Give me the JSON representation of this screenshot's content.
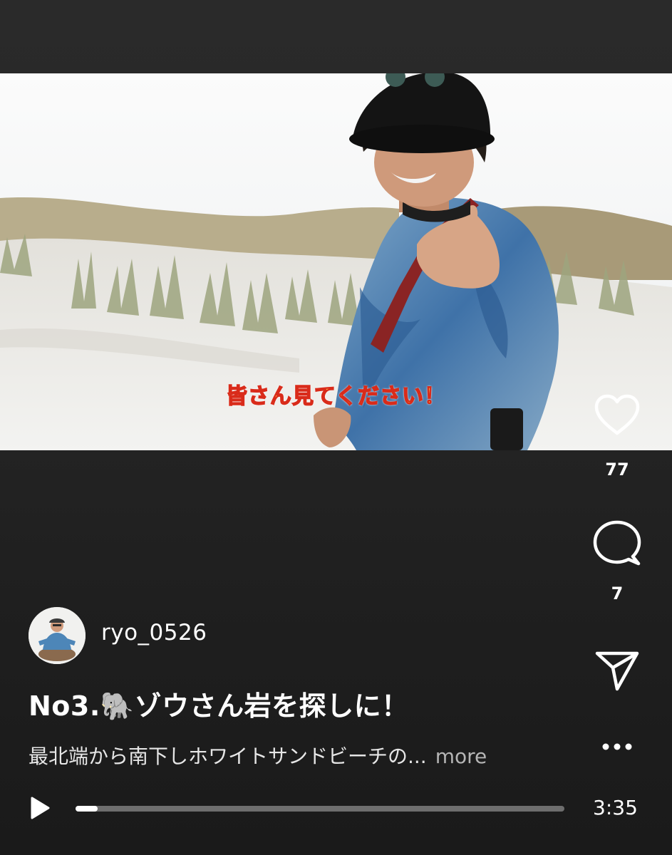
{
  "video": {
    "subtitle": "皆さん見てください！"
  },
  "actions": {
    "like": {
      "icon": "heart-icon",
      "count": "77"
    },
    "comment": {
      "icon": "comment-bubble-icon",
      "count": "7"
    },
    "share": {
      "icon": "paper-plane-icon"
    },
    "more": {
      "icon": "more-dots-icon",
      "label": "•••"
    }
  },
  "post": {
    "username": "ryo_0526",
    "title": "No3.🐘ゾウさん岩を探しに！",
    "description": "最北端から南下しホワイトサンドビーチの...",
    "more_label": "more"
  },
  "player": {
    "play_icon": "play-icon",
    "progress": 0.045,
    "duration": "3:35"
  }
}
